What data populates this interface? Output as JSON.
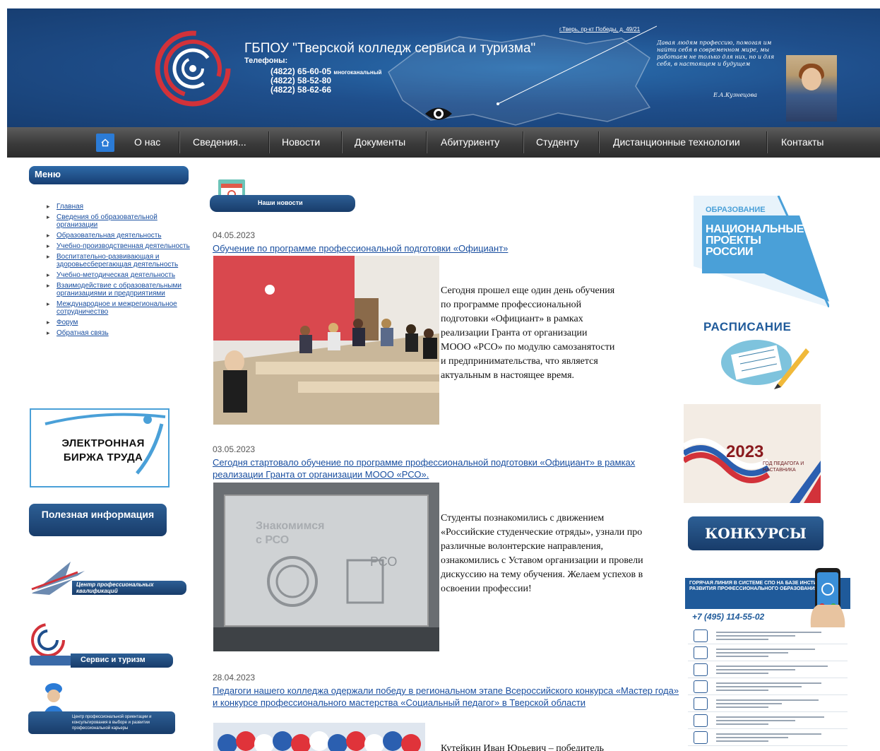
{
  "header": {
    "title": "ГБПОУ \"Тверской колледж сервиса и туризма\"",
    "phones_label": "Телефоны:",
    "phones": [
      "(4822) 65-60-05",
      "(4822) 58-52-80",
      "(4822) 58-62-66"
    ],
    "phone_note": "многоканальный",
    "address": "г.Тверь, пр-кт Победы, д. 49/21",
    "quote": "Давая людям профессию, помогая им найти себя в современном мире, мы работаем не только для них, но и для себя, в настоящем и будущем",
    "signature": "Е.А.Кузнецова"
  },
  "nav": {
    "items": [
      "О нас",
      "Сведения...",
      "Новости",
      "Документы",
      "Абитуриенту",
      "Студенту",
      "Дистанционные технологии",
      "Контакты"
    ]
  },
  "sidebar": {
    "menu_title": "Меню",
    "menu_items": [
      "Главная",
      "Сведения об образовательной организации",
      "Образовательная деятельность",
      "Учебно-производственная деятельность",
      "Воспитательно-развивающая и здоровьесберегающая деятельность",
      "Учебно-методическая деятельность",
      "Взаимодействие с образовательными организациями и предприятиями",
      "Международное и межрегиональное сотрудничество",
      "Форум",
      "Обратная связь"
    ],
    "birzha": "ЭЛЕКТРОННАЯ БИРЖА ТРУДА",
    "useful": "Полезная информация",
    "cpk": "Центр профессиональных квалификаций",
    "service": "Сервис и туризм",
    "career": "Центр профессиональной ориентации и консультирования в выборе и развитии профессиональной карьеры"
  },
  "news": {
    "header": "Наши новости",
    "items": [
      {
        "date": "04.05.2023",
        "title": "Обучение по программе профессиональной подготовки «Официант»",
        "text": "Сегодня прошел еще один день обучения по программе профессиональной подготовки «Официант» в рамках реализации Гранта от организации МООО «РСО» по модулю самозанятости и предпринимательства, что является актуальным в настоящее время."
      },
      {
        "date": "03.05.2023",
        "title": "Сегодня стартовало обучение по программе профессиональной подготовки «Официант» в рамках реализации Гранта от организации МООО «РСО».",
        "text": " Студенты познакомились с движением «Российские студенческие отряды», узнали про различные волонтерские направления, ознакомились с Уставом организации и провели дискуссию на тему обучения. Желаем успехов в освоении профессии!",
        "slide_line1": "Знакомимся",
        "slide_line2": "с РСО",
        "slide_logo": "РСО"
      },
      {
        "date": "28.04.2023",
        "title": "Педагоги нашего колледжа одержали победу в региональном этапе Всероссийского конкурса «Мастер года» и конкурсе профессионального мастерства «Социальный педагог» в Тверской области",
        "text": "Кутейкин Иван Юрьевич – победитель"
      }
    ]
  },
  "right": {
    "np_small": "ОБРАЗОВАНИЕ",
    "np_big": "НАЦИОНАЛЬНЫЕ ПРОЕКТЫ РОССИИ",
    "raspisanie": "РАСПИСАНИЕ",
    "year_num": "2023",
    "year_text": "ГОД ПЕДАГОГА И НАСТАВНИКА",
    "konkursy": "КОНКУРСЫ",
    "hotline_head": "ГОРЯЧАЯ ЛИНИЯ В СИСТЕМЕ СПО НА БАЗЕ ИНСТИТУТА РАЗВИТИЯ ПРОФЕССИОНАЛЬНОГО ОБРАЗОВАНИЯ",
    "hotline_phone": "+7 (495) 114-55-02"
  },
  "colors": {
    "brand_blue": "#1f4f8c",
    "nav_dark": "#3a3a3a",
    "link_blue": "#1a4fa0"
  }
}
